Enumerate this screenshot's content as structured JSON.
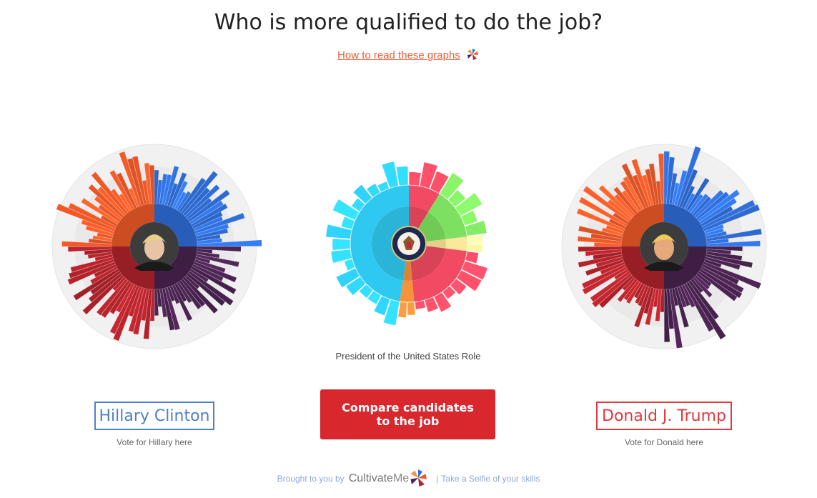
{
  "header": {
    "title": "Who is more qualified to do the job?",
    "howto_link": "How to read these graphs"
  },
  "colors": {
    "knowledge": "#2f6fdb",
    "skills": "#f05a28",
    "abilities": "#b3232b",
    "experience": "#4a2350",
    "role_cyan": "#2ec8f0",
    "role_red": "#f14a62",
    "role_green": "#7ee060",
    "role_yellow": "#fbe89a",
    "role_orange": "#f5933a",
    "accent_red": "#d9272e",
    "hillary_blue": "#4f7fc9",
    "trump_red": "#e0393e"
  },
  "charts": {
    "hillary": {
      "photo_icon": "hillary-photo"
    },
    "role": {
      "center_icon": "presidential-seal-icon",
      "caption": "President of the United States Role"
    },
    "trump": {
      "photo_icon": "trump-photo"
    }
  },
  "candidates": {
    "hillary": {
      "name": "Hillary Clinton",
      "vote": "Vote for Hillary here"
    },
    "trump": {
      "name": "Donald J. Trump",
      "vote": "Vote for Donald here"
    }
  },
  "compare_button": {
    "line1": "Compare candidates",
    "line2": "to the job"
  },
  "footer": {
    "brought": "Brought to you by",
    "brand_a": "Cultivate",
    "brand_b": "Me",
    "sep": "|",
    "selfie_link": "Take a Selfie of your skills"
  }
}
